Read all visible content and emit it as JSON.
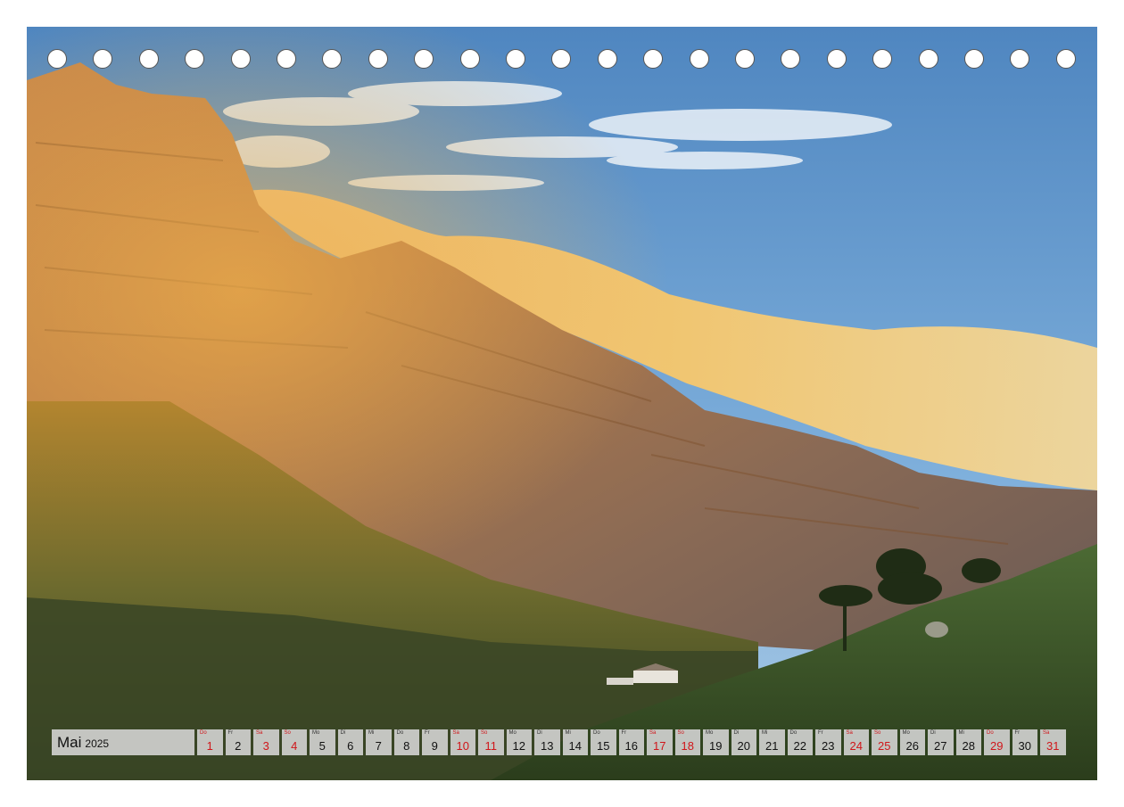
{
  "calendar": {
    "month": "Mai",
    "year": "2025",
    "days": [
      {
        "wd": "Do",
        "num": "1",
        "red": true
      },
      {
        "wd": "Fr",
        "num": "2",
        "red": false
      },
      {
        "wd": "Sa",
        "num": "3",
        "red": true
      },
      {
        "wd": "So",
        "num": "4",
        "red": true
      },
      {
        "wd": "Mo",
        "num": "5",
        "red": false
      },
      {
        "wd": "Di",
        "num": "6",
        "red": false
      },
      {
        "wd": "Mi",
        "num": "7",
        "red": false
      },
      {
        "wd": "Do",
        "num": "8",
        "red": false
      },
      {
        "wd": "Fr",
        "num": "9",
        "red": false
      },
      {
        "wd": "Sa",
        "num": "10",
        "red": true
      },
      {
        "wd": "So",
        "num": "11",
        "red": true
      },
      {
        "wd": "Mo",
        "num": "12",
        "red": false
      },
      {
        "wd": "Di",
        "num": "13",
        "red": false
      },
      {
        "wd": "Mi",
        "num": "14",
        "red": false
      },
      {
        "wd": "Do",
        "num": "15",
        "red": false
      },
      {
        "wd": "Fr",
        "num": "16",
        "red": false
      },
      {
        "wd": "Sa",
        "num": "17",
        "red": true
      },
      {
        "wd": "So",
        "num": "18",
        "red": true
      },
      {
        "wd": "Mo",
        "num": "19",
        "red": false
      },
      {
        "wd": "Di",
        "num": "20",
        "red": false
      },
      {
        "wd": "Mi",
        "num": "21",
        "red": false
      },
      {
        "wd": "Do",
        "num": "22",
        "red": false
      },
      {
        "wd": "Fr",
        "num": "23",
        "red": false
      },
      {
        "wd": "Sa",
        "num": "24",
        "red": true
      },
      {
        "wd": "So",
        "num": "25",
        "red": true
      },
      {
        "wd": "Mo",
        "num": "26",
        "red": false
      },
      {
        "wd": "Di",
        "num": "27",
        "red": false
      },
      {
        "wd": "Mi",
        "num": "28",
        "red": false
      },
      {
        "wd": "Do",
        "num": "29",
        "red": true
      },
      {
        "wd": "Fr",
        "num": "30",
        "red": false
      },
      {
        "wd": "Sa",
        "num": "31",
        "red": true
      }
    ]
  },
  "colors": {
    "sky": "#5c8fc4",
    "cliff": "#b9753a",
    "cloud": "#f6c46a",
    "grass": "#3f5a2c",
    "holiday": "#d0161a"
  },
  "binding_holes": 23
}
